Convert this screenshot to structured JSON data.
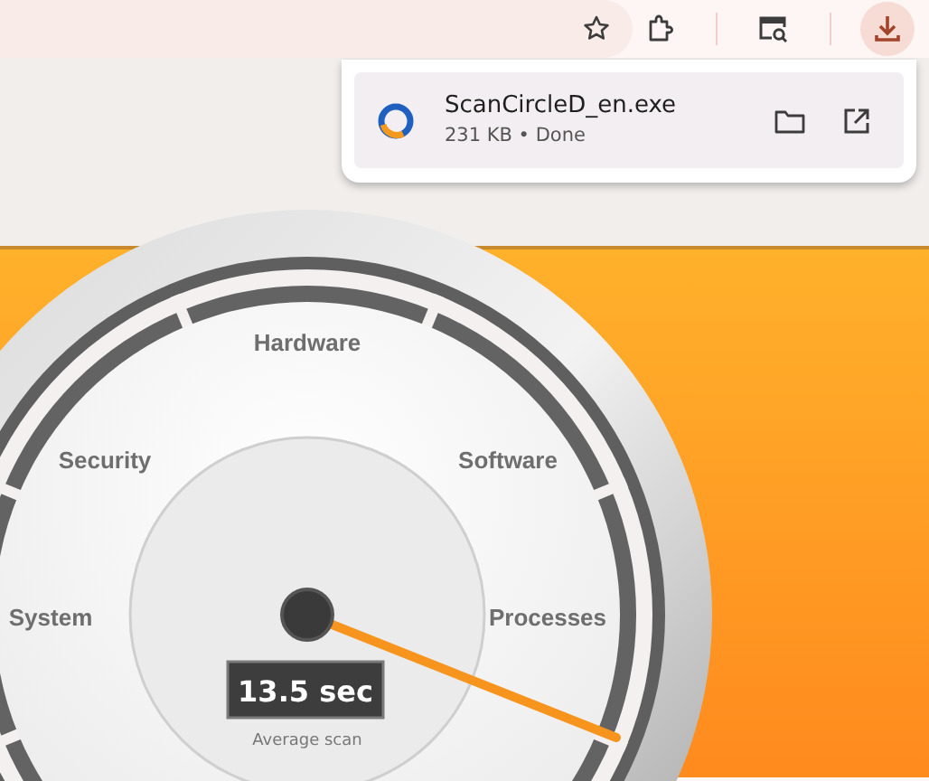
{
  "toolbar": {
    "download_button": {
      "selected": true
    }
  },
  "download_popup": {
    "filename": "ScanCircleD_en.exe",
    "meta": "231 KB • Done"
  },
  "gauge": {
    "labels": [
      "Hardware",
      "Security",
      "Software",
      "System",
      "Processes"
    ],
    "value": "13.5 sec",
    "caption": "Average scan"
  }
}
